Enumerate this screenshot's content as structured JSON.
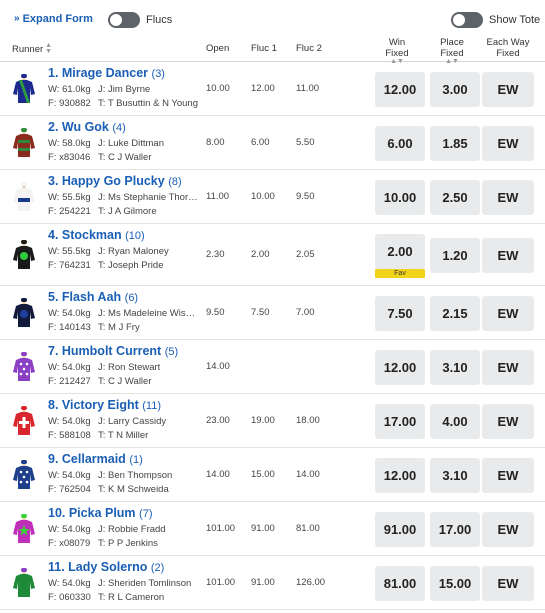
{
  "topbar": {
    "expand_label": "Expand Form",
    "flucs_label": "Flucs",
    "tote_label": "Show Tote"
  },
  "header": {
    "runner": "Runner",
    "open": "Open",
    "fluc1": "Fluc 1",
    "fluc2": "Fluc 2",
    "win": "Win",
    "win2": "Fixed",
    "place": "Place",
    "place2": "Fixed",
    "ew": "Each Way",
    "ew2": "Fixed"
  },
  "runners": [
    {
      "name": "1. Mirage Dancer",
      "barrier": "(3)",
      "weight": "W: 61.0kg",
      "jockey": "J: Jim Byrne",
      "form": "F: 930882",
      "trainer": "T: T Busuttin & N Young",
      "open": "10.00",
      "fluc1": "12.00",
      "fluc2": "11.00",
      "win": "12.00",
      "place": "3.00",
      "ew": "EW",
      "fav": "",
      "silk": {
        "body": "#1b2a8c",
        "sash": "#2e9e3e",
        "cap": "#1b2a8c",
        "pattern": "sash"
      }
    },
    {
      "name": "2. Wu Gok",
      "barrier": "(4)",
      "weight": "W: 58.0kg",
      "jockey": "J: Luke Dittman",
      "form": "F: x83046",
      "trainer": "T: C J Waller",
      "open": "8.00",
      "fluc1": "6.00",
      "fluc2": "5.50",
      "win": "6.00",
      "place": "1.85",
      "ew": "EW",
      "fav": "",
      "silk": {
        "body": "#8b2a1e",
        "sash": "#2e8b3e",
        "cap": "#2e8b3e",
        "pattern": "hoops"
      }
    },
    {
      "name": "3. Happy Go Plucky",
      "barrier": "(8)",
      "weight": "W: 55.5kg",
      "jockey": "J: Ms Stephanie Thornton",
      "form": "F: 254221",
      "trainer": "T: J A Gilmore",
      "open": "11.00",
      "fluc1": "10.00",
      "fluc2": "9.50",
      "win": "10.00",
      "place": "2.50",
      "ew": "EW",
      "fav": "",
      "silk": {
        "body": "#f4f4f4",
        "sash": "#1b3a8c",
        "cap": "#f4f4f4",
        "pattern": "band"
      }
    },
    {
      "name": "4. Stockman",
      "barrier": "(10)",
      "weight": "W: 55.5kg",
      "jockey": "J: Ryan Maloney",
      "form": "F: 764231",
      "trainer": "T: Joseph Pride",
      "open": "2.30",
      "fluc1": "2.00",
      "fluc2": "2.05",
      "win": "2.00",
      "place": "1.20",
      "ew": "EW",
      "fav": "Fav",
      "silk": {
        "body": "#1a1a1a",
        "sash": "#2ecc40",
        "cap": "#1a1a1a",
        "pattern": "dot"
      }
    },
    {
      "name": "5. Flash Aah",
      "barrier": "(6)",
      "weight": "W: 54.0kg",
      "jockey": "J: Ms Madeleine Wishart",
      "form": "F: 140143",
      "trainer": "T: M J Fry",
      "open": "9.50",
      "fluc1": "7.50",
      "fluc2": "7.00",
      "win": "7.50",
      "place": "2.15",
      "ew": "EW",
      "fav": "",
      "silk": {
        "body": "#111a3a",
        "sash": "#1e3fa0",
        "cap": "#111a3a",
        "pattern": "dot"
      }
    },
    {
      "name": "7. Humbolt Current",
      "barrier": "(5)",
      "weight": "W: 54.0kg",
      "jockey": "J: Ron Stewart",
      "form": "F: 212427",
      "trainer": "T: C J Waller",
      "open": "14.00",
      "fluc1": "",
      "fluc2": "",
      "win": "12.00",
      "place": "3.10",
      "ew": "EW",
      "fav": "",
      "silk": {
        "body": "#8a3fc4",
        "sash": "#ffffff",
        "cap": "#8a3fc4",
        "pattern": "spots"
      }
    },
    {
      "name": "8. Victory Eight",
      "barrier": "(11)",
      "weight": "W: 54.0kg",
      "jockey": "J: Larry Cassidy",
      "form": "F: 588108",
      "trainer": "T: T N Miller",
      "open": "23.00",
      "fluc1": "19.00",
      "fluc2": "18.00",
      "win": "17.00",
      "place": "4.00",
      "ew": "EW",
      "fav": "",
      "silk": {
        "body": "#d9262e",
        "sash": "#ffffff",
        "cap": "#d9262e",
        "pattern": "cross"
      }
    },
    {
      "name": "9. Cellarmaid",
      "barrier": "(1)",
      "weight": "W: 54.0kg",
      "jockey": "J: Ben Thompson",
      "form": "F: 762504",
      "trainer": "T: K M Schweida",
      "open": "14.00",
      "fluc1": "15.00",
      "fluc2": "14.00",
      "win": "12.00",
      "place": "3.10",
      "ew": "EW",
      "fav": "",
      "silk": {
        "body": "#1e3f8c",
        "sash": "#ffffff",
        "cap": "#1e3f8c",
        "pattern": "spots"
      }
    },
    {
      "name": "10. Picka Plum",
      "barrier": "(7)",
      "weight": "W: 54.0kg",
      "jockey": "J: Robbie Fradd",
      "form": "F: x08079",
      "trainer": "T: P P Jenkins",
      "open": "101.00",
      "fluc1": "91.00",
      "fluc2": "81.00",
      "win": "91.00",
      "place": "17.00",
      "ew": "EW",
      "fav": "",
      "silk": {
        "body": "#c02fb8",
        "sash": "#3ccf3c",
        "cap": "#3ccf3c",
        "pattern": "star"
      }
    },
    {
      "name": "11. Lady Solerno",
      "barrier": "(2)",
      "weight": "W: 54.0kg",
      "jockey": "J: Sheriden Tomlinson",
      "form": "F: 060330",
      "trainer": "T: R L Cameron",
      "open": "101.00",
      "fluc1": "91.00",
      "fluc2": "126.00",
      "win": "81.00",
      "place": "15.00",
      "ew": "EW",
      "fav": "",
      "silk": {
        "body": "#1f8a3a",
        "sash": "#1f8a3a",
        "cap": "#8a3fc4",
        "pattern": "plain"
      }
    }
  ]
}
